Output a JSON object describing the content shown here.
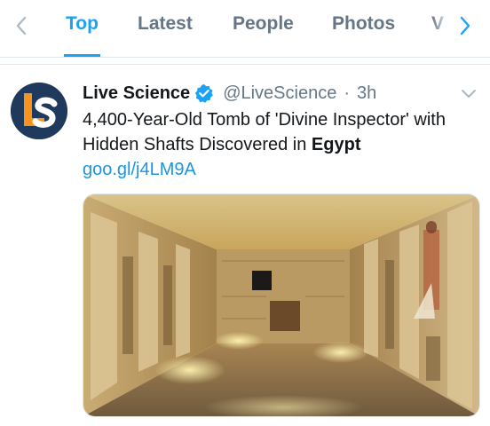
{
  "tabs": {
    "items": [
      {
        "label": "Top",
        "active": true
      },
      {
        "label": "Latest",
        "active": false
      },
      {
        "label": "People",
        "active": false
      },
      {
        "label": "Photos",
        "active": false
      },
      {
        "label": "V",
        "active": false
      }
    ],
    "prev_icon": "chevron-left-icon",
    "next_icon": "chevron-right-icon"
  },
  "tweet": {
    "avatar_text": "LS",
    "display_name": "Live Science",
    "verified_icon": "verified-badge-icon",
    "handle": "@LiveScience",
    "separator": "·",
    "time": "3h",
    "menu_icon": "chevron-down-icon",
    "text_part1": "4,400-Year-Old Tomb of 'Divine Inspector' with Hidden Shafts Discovered in ",
    "text_bold": "Egypt",
    "link": "goo.gl/j4LM9A",
    "media_alt": "tomb-interior-photo"
  },
  "colors": {
    "accent": "#1da1f2",
    "link": "#1b95e0",
    "muted": "#657786",
    "avatar_bg": "#1f3a5c",
    "avatar_orange": "#f7941d"
  }
}
